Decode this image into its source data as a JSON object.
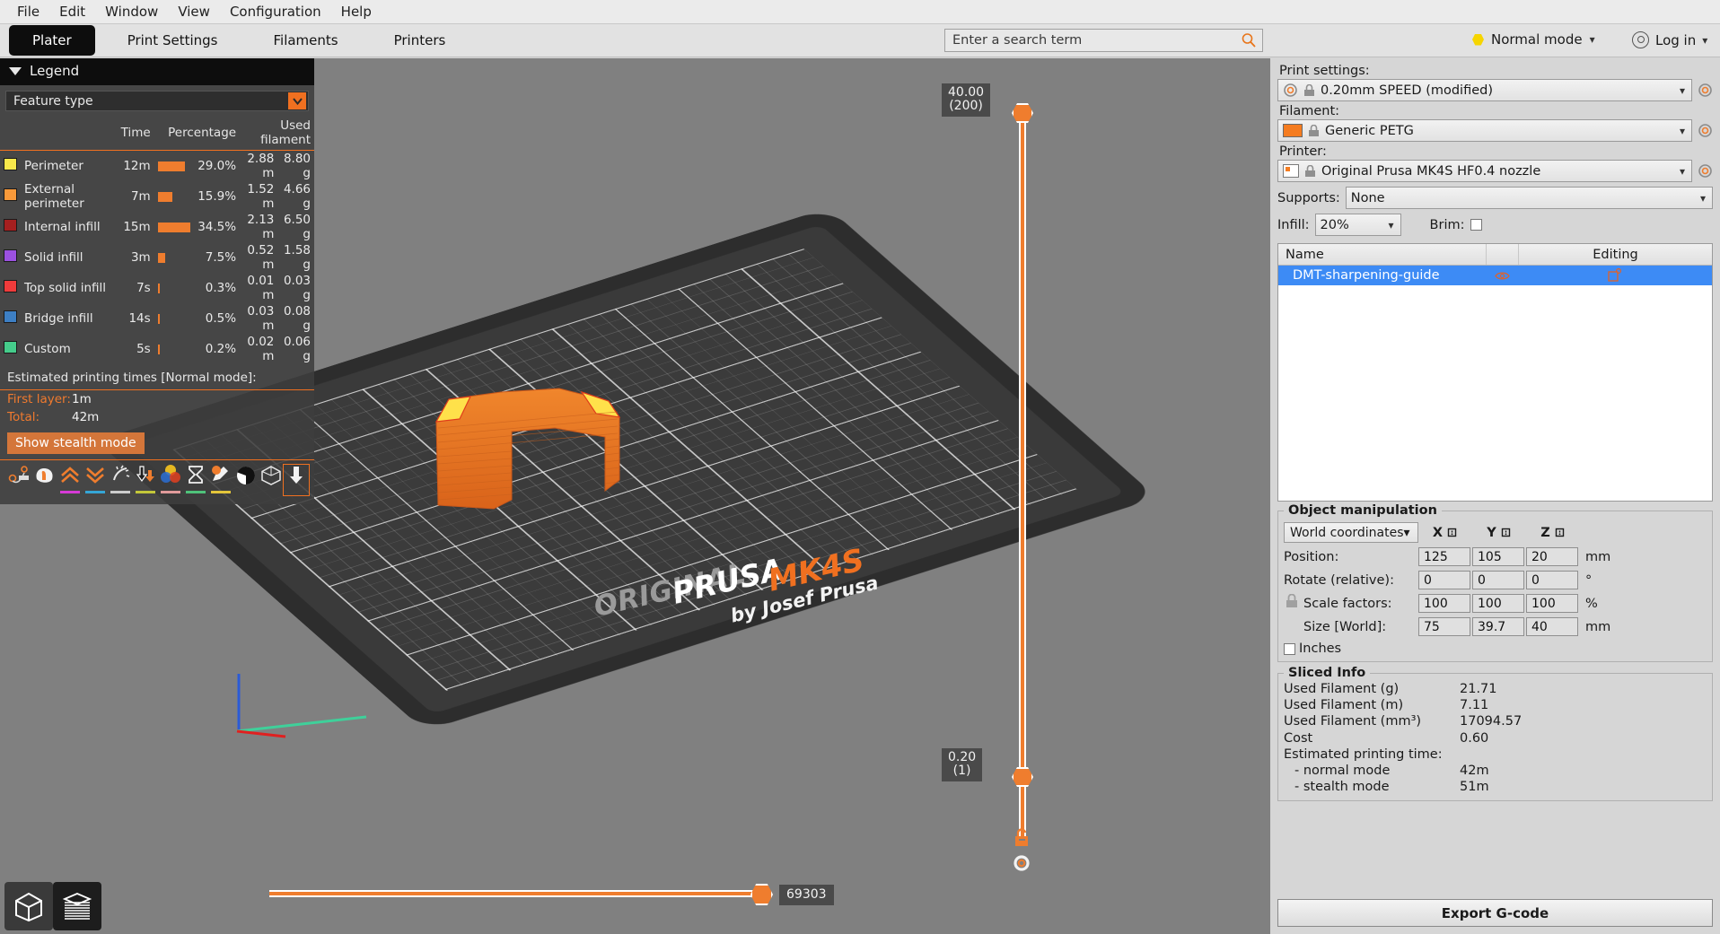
{
  "menubar": {
    "items": [
      "File",
      "Edit",
      "Window",
      "View",
      "Configuration",
      "Help"
    ]
  },
  "tabs": [
    {
      "label": "Plater",
      "active": true
    },
    {
      "label": "Print Settings",
      "active": false
    },
    {
      "label": "Filaments",
      "active": false
    },
    {
      "label": "Printers",
      "active": false
    }
  ],
  "search": {
    "placeholder": "Enter a search term",
    "value": "",
    "icon": "search-icon"
  },
  "mode": {
    "label": "Normal mode",
    "color": "#f6d500",
    "icon": "chevron-down-icon"
  },
  "account": {
    "label": "Log in",
    "icon": "user-circle-icon"
  },
  "legend": {
    "title": "Legend",
    "view_select": "Feature type",
    "columns": [
      "Time",
      "Percentage",
      "Used filament"
    ],
    "rows": [
      {
        "color": "#f7e84b",
        "name": "Perimeter",
        "time": "12m",
        "bar_pct": 84,
        "percentage": "29.0%",
        "length": "2.88 m",
        "weight": "8.80 g"
      },
      {
        "color": "#f99a3a",
        "name": "External perimeter",
        "time": "7m",
        "bar_pct": 46,
        "percentage": "15.9%",
        "length": "1.52 m",
        "weight": "4.66 g"
      },
      {
        "color": "#a51f1f",
        "name": "Internal infill",
        "time": "15m",
        "bar_pct": 100,
        "percentage": "34.5%",
        "length": "2.13 m",
        "weight": "6.50 g"
      },
      {
        "color": "#9b51e0",
        "name": "Solid infill",
        "time": "3m",
        "bar_pct": 22,
        "percentage": "7.5%",
        "length": "0.52 m",
        "weight": "1.58 g"
      },
      {
        "color": "#ef3b3b",
        "name": "Top solid infill",
        "time": "7s",
        "bar_pct": 2,
        "percentage": "0.3%",
        "length": "0.01 m",
        "weight": "0.03 g"
      },
      {
        "color": "#3d7fc4",
        "name": "Bridge infill",
        "time": "14s",
        "bar_pct": 2,
        "percentage": "0.5%",
        "length": "0.03 m",
        "weight": "0.08 g"
      },
      {
        "color": "#45cc8b",
        "name": "Custom",
        "time": "5s",
        "bar_pct": 2,
        "percentage": "0.2%",
        "length": "0.02 m",
        "weight": "0.06 g"
      }
    ],
    "est_header": "Estimated printing times [Normal mode]:",
    "first_layer_label": "First layer:",
    "first_layer_value": "1m",
    "total_label": "Total:",
    "total_value": "42m",
    "stealth_button": "Show stealth mode",
    "toolbar_icons": [
      {
        "name": "travel-icon",
        "underline": ""
      },
      {
        "name": "retractions-icon",
        "underline": ""
      },
      {
        "name": "seams-icon",
        "underline": "#d63bd6"
      },
      {
        "name": "deretractions-icon",
        "underline": "#35a6d6"
      },
      {
        "name": "wipe-icon",
        "underline": "#cccccc"
      },
      {
        "name": "tool-changes-icon",
        "underline": "#c3c73a"
      },
      {
        "name": "color-changes-icon",
        "underline": "#e09a9a"
      },
      {
        "name": "pause-prints-icon",
        "underline": "#4fc27a"
      },
      {
        "name": "custom-gcodes-icon",
        "underline": "#e3c53a"
      },
      {
        "name": "shells-icon",
        "underline": ""
      },
      {
        "name": "tool-marker-icon",
        "underline": ""
      },
      {
        "name": "legend-toggle-icon",
        "underline": ""
      }
    ]
  },
  "bed": {
    "logo_original": "ORIGINAL",
    "logo_prusa": "PRUSA",
    "logo_model": "MK4S",
    "logo_by": "by Josef Prusa"
  },
  "vertical_slider": {
    "top_label_value": "40.00",
    "top_label_layer": "(200)",
    "bottom_label_value": "0.20",
    "bottom_label_layer": "(1)",
    "lock_icon": "unlock-icon",
    "gear_icon": "gear-icon"
  },
  "horizontal_slider": {
    "value": "69303"
  },
  "view_buttons": [
    {
      "name": "3d-editor-view-button",
      "icon": "cube-icon",
      "active": false
    },
    {
      "name": "preview-view-button",
      "icon": "layers-icon",
      "active": true
    }
  ],
  "sidebar": {
    "print_settings_label": "Print settings:",
    "print_settings_value": "0.20mm SPEED (modified)",
    "filament_label": "Filament:",
    "filament_value": "Generic PETG",
    "filament_color": "#f57c20",
    "printer_label": "Printer:",
    "printer_value": "Original Prusa MK4S HF0.4 nozzle",
    "supports_label": "Supports:",
    "supports_value": "None",
    "infill_label": "Infill:",
    "infill_value": "20%",
    "brim_label": "Brim:",
    "brim_checked": false,
    "object_list": {
      "columns": [
        "Name",
        "",
        "Editing"
      ],
      "rows": [
        {
          "name": "DMT-sharpening-guide",
          "eye_icon": "eye-icon",
          "editing_icon": "settings-badge-icon",
          "selected": true
        }
      ]
    },
    "object_manipulation": {
      "title": "Object manipulation",
      "coordinate_system": "World coordinates",
      "axes": [
        "X",
        "Y",
        "Z"
      ],
      "rows": [
        {
          "label": "Position:",
          "indent": false,
          "values": [
            "125",
            "105",
            "20"
          ],
          "unit": "mm"
        },
        {
          "label": "Rotate (relative):",
          "indent": false,
          "values": [
            "0",
            "0",
            "0"
          ],
          "unit": "°"
        },
        {
          "label": "Scale factors:",
          "indent": true,
          "values": [
            "100",
            "100",
            "100"
          ],
          "unit": "%"
        },
        {
          "label": "Size [World]:",
          "indent": true,
          "values": [
            "75",
            "39.7",
            "40"
          ],
          "unit": "mm"
        }
      ],
      "inches_label": "Inches",
      "inches_checked": false,
      "lock_icon": "uniform-scale-lock-icon"
    },
    "sliced_info": {
      "title": "Sliced Info",
      "rows": [
        {
          "key": "Used Filament (g)",
          "value": "21.71",
          "sub": false
        },
        {
          "key": "Used Filament (m)",
          "value": "7.11",
          "sub": false
        },
        {
          "key": "Used Filament (mm³)",
          "value": "17094.57",
          "sub": false
        },
        {
          "key": "Cost",
          "value": "0.60",
          "sub": false
        },
        {
          "key": "Estimated printing time:",
          "value": "",
          "sub": false
        },
        {
          "key": "- normal mode",
          "value": "42m",
          "sub": true
        },
        {
          "key": "- stealth mode",
          "value": "51m",
          "sub": true
        }
      ]
    },
    "export_button": "Export G-code"
  }
}
